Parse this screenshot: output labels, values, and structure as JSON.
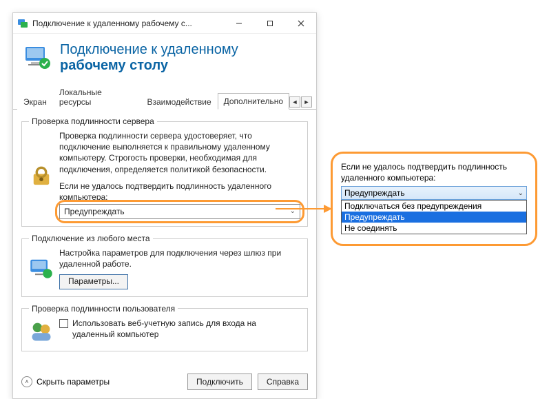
{
  "window": {
    "title": "Подключение к удаленному рабочему с..."
  },
  "banner": {
    "line1": "Подключение к удаленному",
    "line2": "рабочему столу"
  },
  "tabs": [
    {
      "label": "Экран",
      "active": false
    },
    {
      "label": "Локальные ресурсы",
      "active": false
    },
    {
      "label": "Взаимодействие",
      "active": false
    },
    {
      "label": "Дополнительно",
      "active": true
    }
  ],
  "server_auth": {
    "legend": "Проверка подлинности сервера",
    "desc": "Проверка подлинности сервера удостоверяет, что подключение выполняется к правильному удаленному компьютеру. Строгость проверки, необходимая для подключения, определяется политикой безопасности.",
    "prompt": "Если не удалось подтвердить подлинность удаленного компьютера:",
    "dropdown_value": "Предупреждать"
  },
  "gateway": {
    "legend": "Подключение из любого места",
    "desc": "Настройка параметров для подключения через шлюз при удаленной работе.",
    "button": "Параметры..."
  },
  "user_auth": {
    "legend": "Проверка подлинности пользователя",
    "checkbox_label": "Использовать веб-учетную запись для входа на удаленный компьютер"
  },
  "footer": {
    "hide": "Скрыть параметры",
    "connect": "Подключить",
    "help": "Справка"
  },
  "callout": {
    "prompt": "Если не удалось подтвердить подлинность удаленного компьютера:",
    "selected": "Предупреждать",
    "options": [
      "Подключаться без предупреждения",
      "Предупреждать",
      "Не соединять"
    ]
  }
}
